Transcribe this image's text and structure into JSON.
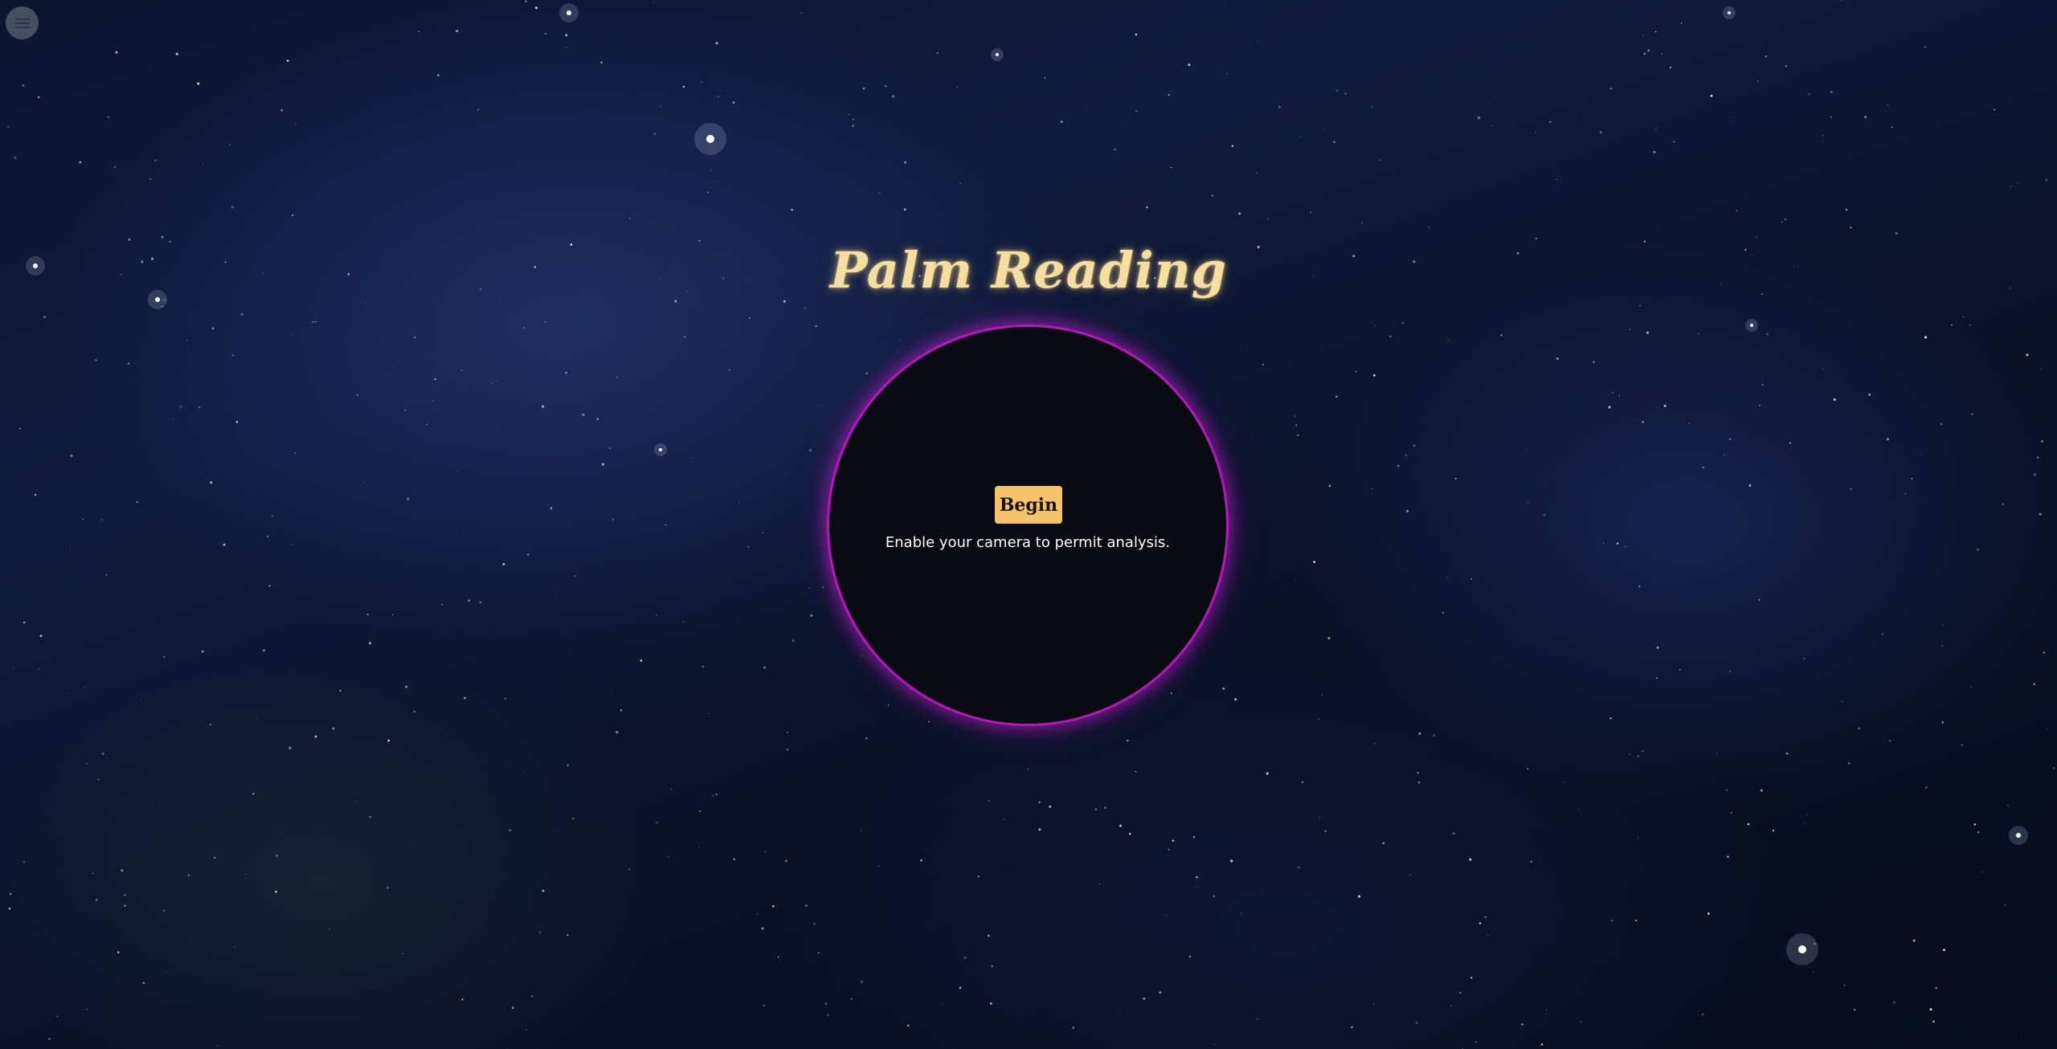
{
  "app": {
    "title": "Palm Reading"
  },
  "menu": {
    "icon": "hamburger-menu-icon"
  },
  "camera": {
    "begin_label": "Begin",
    "hint": "Enable your camera to permit analysis."
  },
  "colors": {
    "title": "#f6dea0",
    "button": "#f2c36b",
    "ring": "#b01ab8",
    "circle_fill": "#0a0b12"
  }
}
